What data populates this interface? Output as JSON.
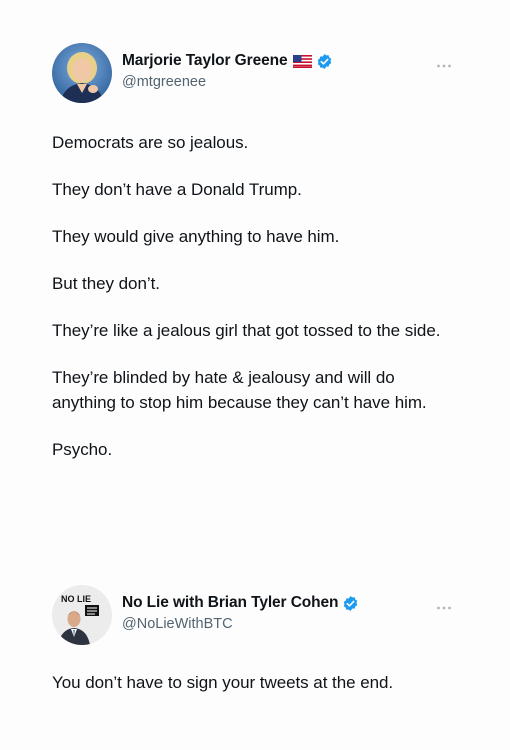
{
  "tweets": [
    {
      "author": {
        "name": "Marjorie Taylor Greene",
        "handle": "@mtgreenee",
        "flag_icon": "us-flag-icon",
        "verified_icon": "verified-badge-icon"
      },
      "more_icon": "more-options-icon",
      "paragraphs": [
        "Democrats are so jealous.",
        "They don’t have a Donald Trump.",
        "They would give anything to have him.",
        "But they don’t.",
        "They’re like a jealous girl that got tossed to the side.",
        "They’re blinded by hate & jealousy and will do anything to stop him because they can’t have him.",
        "Psycho."
      ]
    },
    {
      "author": {
        "name": "No Lie with Brian Tyler Cohen",
        "handle": "@NoLieWithBTC",
        "verified_icon": "verified-badge-icon",
        "avatar_logo_text": "NO LIE"
      },
      "more_icon": "more-options-icon",
      "paragraphs": [
        "You don’t have to sign your tweets at the end."
      ]
    }
  ],
  "colors": {
    "text": "#0f1419",
    "secondary_text": "#536471",
    "verified_blue": "#1d9bf0"
  }
}
